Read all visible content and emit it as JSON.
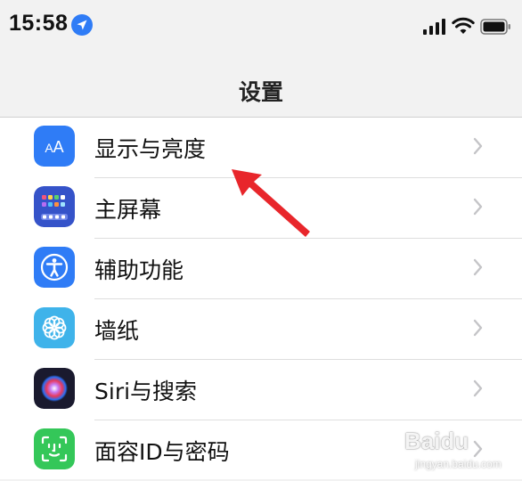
{
  "status_bar": {
    "time": "15:58",
    "location_icon": "location-arrow-icon",
    "signal_icon": "cellular-signal-icon",
    "wifi_icon": "wifi-icon",
    "battery_icon": "battery-icon"
  },
  "nav": {
    "title": "设置"
  },
  "settings_rows": [
    {
      "label": "显示与亮度",
      "icon": "display-brightness-icon",
      "icon_color": "#2f7cf6"
    },
    {
      "label": "主屏幕",
      "icon": "home-screen-icon",
      "icon_color": "#3553c9"
    },
    {
      "label": "辅助功能",
      "icon": "accessibility-icon",
      "icon_color": "#2f7cf6"
    },
    {
      "label": "墙纸",
      "icon": "wallpaper-icon",
      "icon_color": "#3fb3ea"
    },
    {
      "label": "Siri与搜索",
      "icon": "siri-icon",
      "icon_color": "#1a1a2e"
    },
    {
      "label": "面容ID与密码",
      "icon": "face-id-icon",
      "icon_color": "#34c759"
    }
  ],
  "annotation": {
    "icon": "red-arrow-icon",
    "color": "#e8262b"
  },
  "watermark": {
    "text": "Baidu",
    "sub_text": "jingyan.baidu.com"
  }
}
